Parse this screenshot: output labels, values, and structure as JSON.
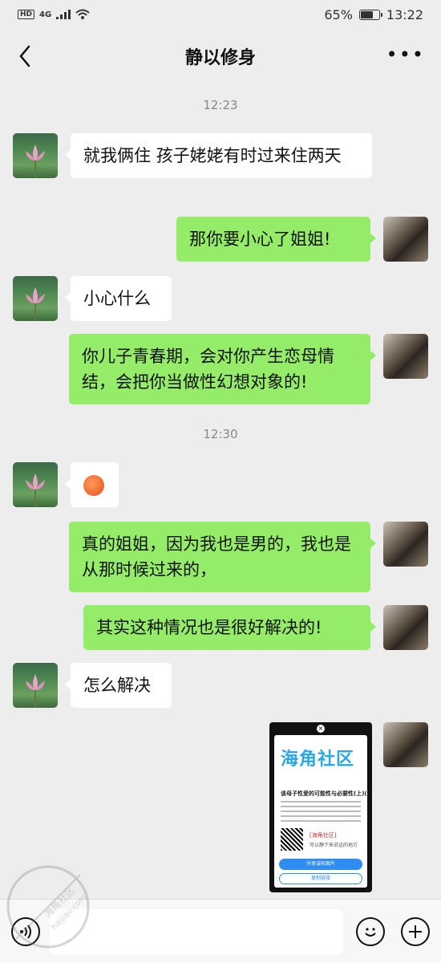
{
  "status_bar": {
    "network": "4G",
    "hd": "HD",
    "battery_percent": "65%",
    "battery_level": 0.65,
    "time": "13:22"
  },
  "header": {
    "title": "静以修身",
    "back_icon": "chevron-left-icon",
    "more_icon": "more-dots-icon"
  },
  "messages": [
    {
      "type": "time",
      "text": "12:23"
    },
    {
      "type": "text",
      "side": "in",
      "text": "就我俩住 孩子姥姥有时过来住两天"
    },
    {
      "type": "text",
      "side": "out",
      "text": "那你要小心了姐姐!"
    },
    {
      "type": "text",
      "side": "in",
      "text": "小心什么"
    },
    {
      "type": "text",
      "side": "out",
      "text": "你儿子青春期，会对你产生恋母情结，会把你当做性幻想对象的!"
    },
    {
      "type": "time",
      "text": "12:30"
    },
    {
      "type": "emoji",
      "side": "in",
      "emoji": "sweat-smile-face-icon"
    },
    {
      "type": "text",
      "side": "out",
      "text": "真的姐姐，因为我也是男的，我也是从那时候过来的，"
    },
    {
      "type": "text",
      "side": "out",
      "text": "其实这种情况也是很好解决的!"
    },
    {
      "type": "text",
      "side": "in",
      "text": "怎么解决"
    },
    {
      "type": "image",
      "side": "out",
      "card": {
        "logo": "海角社区",
        "title": "谈母子性爱的可能性与必要性(上)(...",
        "brand": "[海角社区]",
        "subtitle": "可以静下来说话的地方",
        "button1": "分享该帖图片",
        "button2": "复制链接"
      }
    }
  ],
  "bottom_bar": {
    "voice_icon": "voice-icon",
    "emoji_icon": "emoji-icon",
    "plus_icon": "plus-icon"
  },
  "watermark": {
    "text": "海角社区",
    "url": "haijiao.com"
  }
}
